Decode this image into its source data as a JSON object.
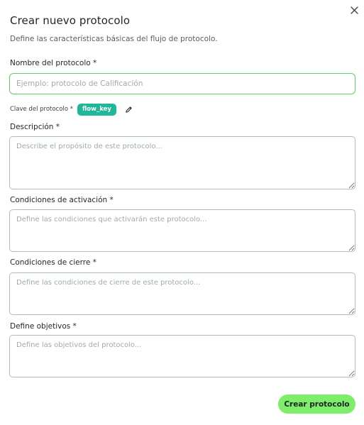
{
  "modal": {
    "title": "Crear nuevo protocolo",
    "subtitle": "Define las características básicas del flujo de protocolo.",
    "close_icon": "close-icon"
  },
  "form": {
    "name": {
      "label": "Nombre del protocolo *",
      "placeholder": "Ejemplo: protocolo de Calificación",
      "value": ""
    },
    "key": {
      "label": "Clave del protocolo *",
      "value": "flow_key",
      "edit_icon": "pencil-icon"
    },
    "description": {
      "label": "Descripción *",
      "placeholder": "Describe el propósito de este protocolo...",
      "value": ""
    },
    "activation": {
      "label": "Condiciones de activación *",
      "placeholder": "Define las condiciones que activarán este protocolo...",
      "value": ""
    },
    "closing": {
      "label": "Condiciones de cierre *",
      "placeholder": "Define las condiciones de cierre de este protocolo...",
      "value": ""
    },
    "objectives": {
      "label": "Define objetivos *",
      "placeholder": "Define las objetivos del protocolo...",
      "value": ""
    }
  },
  "actions": {
    "submit_label": "Crear protocolo"
  },
  "colors": {
    "accent_green": "#7ded6a",
    "focus_border": "#5fd15a",
    "badge_teal": "#1fb79a",
    "field_border": "#aebfb7"
  }
}
